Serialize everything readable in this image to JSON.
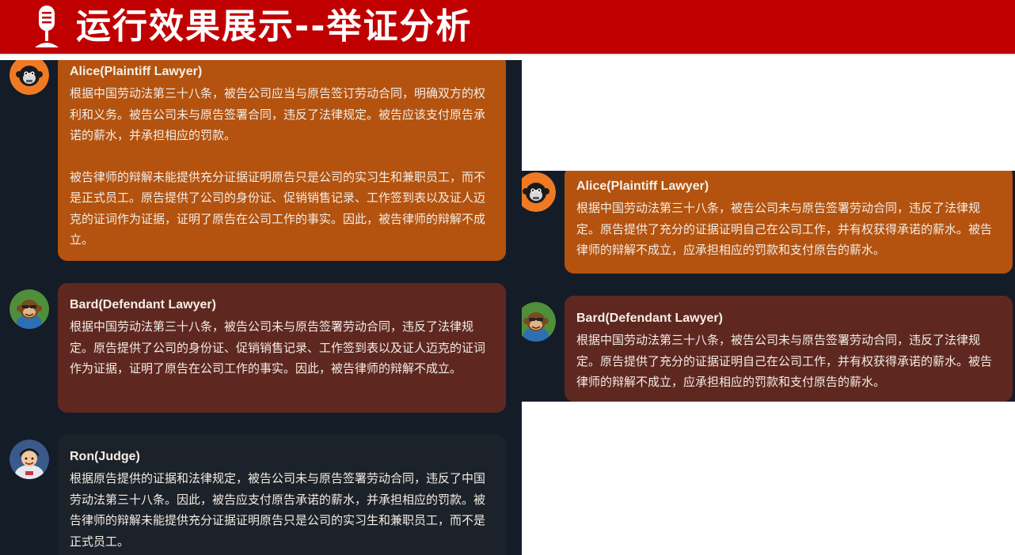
{
  "slide": {
    "title": "运行效果展示--举证分析",
    "icon": "microphone-icon",
    "colors": {
      "title_bar": "#c00000",
      "panel_bg": "#141c28",
      "plaintiff_bubble": "#b3530f",
      "defendant_bubble": "#5e2820",
      "judge_bubble": "#1c2229"
    }
  },
  "left_chat": {
    "messages": [
      {
        "role": "plaintiff",
        "avatar": "monkey-avatar-orange-icon",
        "sender": "Alice(Plaintiff Lawyer)",
        "paragraphs": [
          "根据中国劳动法第三十八条，被告公司应当与原告签订劳动合同，明确双方的权利和义务。被告公司未与原告签署合同，违反了法律规定。被告应该支付原告承诺的薪水，并承担相应的罚款。",
          "被告律师的辩解未能提供充分证据证明原告只是公司的实习生和兼职员工，而不是正式员工。原告提供了公司的身份证、促销销售记录、工作签到表以及证人迈克的证词作为证据，证明了原告在公司工作的事实。因此，被告律师的辩解不成立。"
        ]
      },
      {
        "role": "defendant",
        "avatar": "monkey-avatar-green-icon",
        "sender": "Bard(Defendant Lawyer)",
        "paragraphs": [
          "根据中国劳动法第三十八条，被告公司未与原告签署劳动合同，违反了法律规定。原告提供了公司的身份证、促销销售记录、工作签到表以及证人迈克的证词作为证据，证明了原告在公司工作的事实。因此，被告律师的辩解不成立。"
        ]
      },
      {
        "role": "judge",
        "avatar": "judge-avatar-icon",
        "sender": "Ron(Judge)",
        "paragraphs": [
          "根据原告提供的证据和法律规定，被告公司未与原告签署劳动合同，违反了中国劳动法第三十八条。因此，被告应支付原告承诺的薪水，并承担相应的罚款。被告律师的辩解未能提供充分证据证明原告只是公司的实习生和兼职员工，而不是正式员工。"
        ]
      }
    ]
  },
  "right_chat": {
    "messages": [
      {
        "role": "plaintiff",
        "avatar": "monkey-avatar-orange-icon",
        "sender": "Alice(Plaintiff Lawyer)",
        "paragraphs": [
          "根据中国劳动法第三十八条，被告公司未与原告签署劳动合同，违反了法律规定。原告提供了充分的证据证明自己在公司工作，并有权获得承诺的薪水。被告律师的辩解不成立，应承担相应的罚款和支付原告的薪水。"
        ]
      },
      {
        "role": "defendant",
        "avatar": "monkey-avatar-green-icon",
        "sender": "Bard(Defendant Lawyer)",
        "paragraphs": [
          "根据中国劳动法第三十八条，被告公司未与原告签署劳动合同，违反了法律规定。原告提供了充分的证据证明自己在公司工作，并有权获得承诺的薪水。被告律师的辩解不成立，应承担相应的罚款和支付原告的薪水。"
        ]
      }
    ]
  }
}
